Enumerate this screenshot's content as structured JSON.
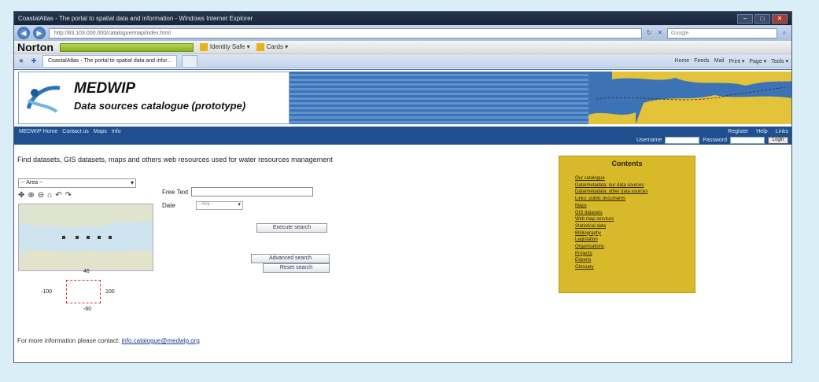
{
  "window": {
    "title": "CoastalAtlas - The portal to spatial data and information - Windows Internet Explorer",
    "minimize": "–",
    "maximize": "□",
    "close": "✕"
  },
  "browser": {
    "address": "http://83.103.000.000/catalogue/map/index.html",
    "search_placeholder": "Google",
    "norton_label": "Norton",
    "toolbar_items": [
      "Identity Safe ▾",
      "Cards ▾"
    ],
    "tab_label": "CoastalAtlas - The portal to spatial data and infor...",
    "commands": [
      "Home",
      "Feeds",
      "Mail",
      "Print ▾",
      "Page ▾",
      "Tools ▾"
    ]
  },
  "site": {
    "title": "MEDWIP",
    "subtitle": "Data sources catalogue (prototype)",
    "menu": [
      "MEDWIP Home",
      "Contact us",
      "Maps",
      "Info"
    ],
    "menu_right": [
      "Register",
      "Help",
      "Links"
    ],
    "username_label": "Username",
    "password_label": "Password",
    "login_button": "Login"
  },
  "main": {
    "headline": "Find datasets, GIS datasets, maps and others web resources used for water resources management",
    "area_select": "-- Area --",
    "free_text_label": "Free Text",
    "free_text_value": "",
    "date_label": "Date",
    "date_select": "- Any -",
    "search_button": "Execute search",
    "advanced_button": "Advanced search",
    "reset_button": "Reset search",
    "bbox": {
      "north": "46",
      "south": "-60",
      "west": "-100",
      "east": "100"
    },
    "contact_text": "For more information please contact:",
    "contact_link": "info.catalogue@medwip.org"
  },
  "contents": {
    "title": "Contents",
    "items": [
      "Our catalogue",
      "Data/metadata: our data sources",
      "Data/metadata: other data sources",
      "Links: public documents",
      "Maps",
      "GIS datasets",
      "Web map services",
      "Statistical data",
      "Bibliography",
      "Legislation",
      "Organisations",
      "Projects",
      "Experts",
      "Glossary"
    ]
  },
  "colors": {
    "banner_blue": "#3c72b6",
    "menu_blue": "#1f4f8f",
    "contents_yellow": "#d8b92a"
  }
}
